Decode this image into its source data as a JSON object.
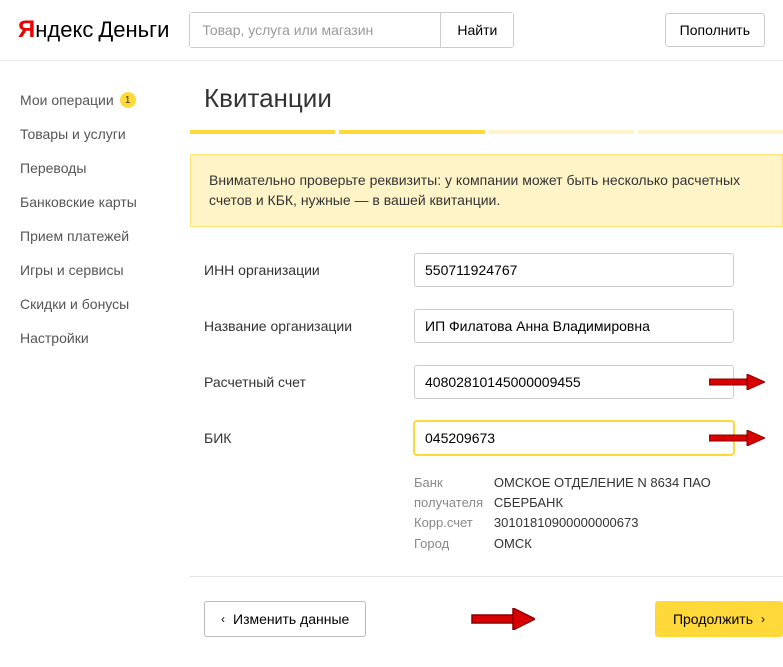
{
  "header": {
    "logo_y": "Я",
    "logo_rest": "ндекс",
    "logo_money": "Деньги",
    "search_placeholder": "Товар, услуга или магазин",
    "search_button": "Найти",
    "topup_button": "Пополнить"
  },
  "sidebar": {
    "items": [
      {
        "label": "Мои операции",
        "badge": "1"
      },
      {
        "label": "Товары и услуги"
      },
      {
        "label": "Переводы"
      },
      {
        "label": "Банковские карты"
      },
      {
        "label": "Прием платежей"
      },
      {
        "label": "Игры и сервисы"
      },
      {
        "label": "Скидки и бонусы"
      },
      {
        "label": "Настройки"
      }
    ]
  },
  "main": {
    "title": "Квитанции",
    "notice": "Внимательно проверьте реквизиты: у компании может быть несколько расчетных счетов и КБК, нужные — в вашей квитанции.",
    "fields": {
      "inn_label": "ИНН организации",
      "inn_value": "550711924767",
      "name_label": "Название организации",
      "name_value": "ИП Филатова Анна Владимировна",
      "account_label": "Расчетный счет",
      "account_value": "40802810145000009455",
      "bik_label": "БИК",
      "bik_value": "045209673"
    },
    "bank": {
      "bank_label": "Банк получателя",
      "bank_value": "ОМСКОЕ ОТДЕЛЕНИЕ N 8634 ПАО СБЕРБАНК",
      "corr_label": "Корр.счет",
      "corr_value": "30101810900000000673",
      "city_label": "Город",
      "city_value": "ОМСК"
    },
    "actions": {
      "back": "Изменить данные",
      "continue": "Продолжить"
    }
  }
}
